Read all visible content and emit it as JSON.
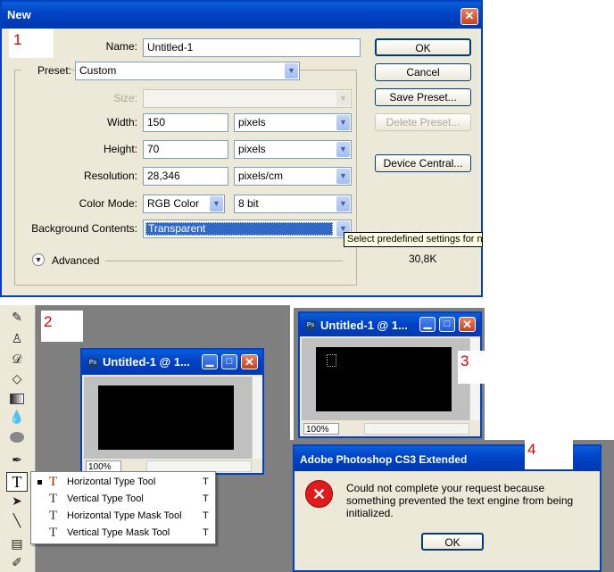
{
  "new_dialog": {
    "title": "New",
    "close": "✕",
    "marker": "1",
    "name_label": "Name:",
    "name_value": "Untitled-1",
    "preset_label": "Preset:",
    "preset_value": "Custom",
    "size_label": "Size:",
    "width_label": "Width:",
    "width_value": "150",
    "width_unit": "pixels",
    "height_label": "Height:",
    "height_value": "70",
    "height_unit": "pixels",
    "resolution_label": "Resolution:",
    "resolution_value": "28,346",
    "resolution_unit": "pixels/cm",
    "color_mode_label": "Color Mode:",
    "color_mode_value": "RGB Color",
    "bit_value": "8 bit",
    "background_label": "Background Contents:",
    "background_value": "Transparent",
    "advanced_label": "Advanced",
    "tooltip": "Select predefined settings for ne",
    "image_size": "30,8K",
    "buttons": {
      "ok": "OK",
      "cancel": "Cancel",
      "save_preset": "Save Preset...",
      "delete_preset": "Delete Preset...",
      "device_central": "Device Central..."
    }
  },
  "panel2": {
    "marker": "2",
    "doc_title": "Untitled-1 @ 1...",
    "zoom": "100%",
    "tool_menu": [
      {
        "label": "Horizontal Type Tool",
        "shortcut": "T",
        "active": true
      },
      {
        "label": "Vertical Type Tool",
        "shortcut": "T",
        "active": false
      },
      {
        "label": "Horizontal Type Mask Tool",
        "shortcut": "T",
        "active": false
      },
      {
        "label": "Vertical Type Mask Tool",
        "shortcut": "T",
        "active": false
      }
    ],
    "type_tool_glyph": "T"
  },
  "panel3": {
    "marker": "3",
    "doc_title": "Untitled-1 @ 1...",
    "zoom": "100%"
  },
  "error_dialog": {
    "marker": "4",
    "title": "Adobe Photoshop CS3 Extended",
    "message": "Could not complete your request because something prevented the text engine from being initialized.",
    "ok": "OK",
    "icon": "✕"
  },
  "colors": {
    "xp_blue": "#0042c6",
    "dialog_bg": "#ece9d8",
    "workspace_gray": "#7f7f7f",
    "marker_red": "#e00000"
  }
}
